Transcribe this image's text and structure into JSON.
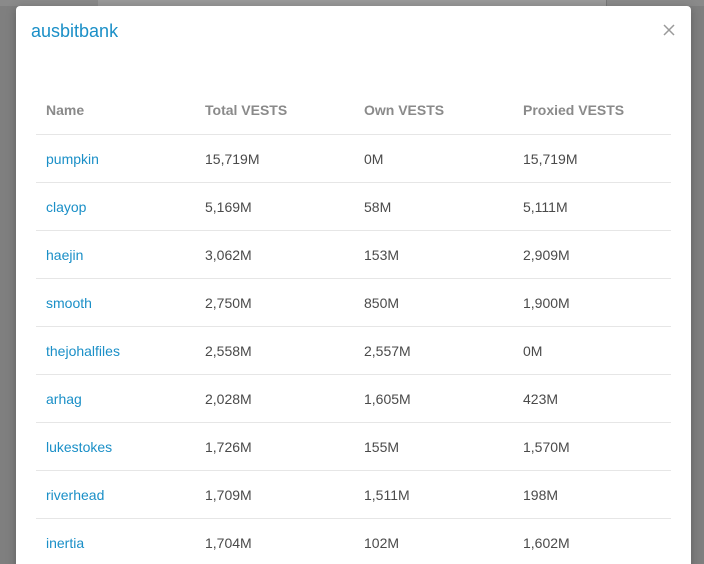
{
  "modal": {
    "title": "ausbitbank",
    "close_label": "×"
  },
  "table": {
    "headers": [
      "Name",
      "Total VESTS",
      "Own VESTS",
      "Proxied VESTS"
    ],
    "rows": [
      {
        "name": "pumpkin",
        "total": "15,719M",
        "own": "0M",
        "proxied": "15,719M"
      },
      {
        "name": "clayop",
        "total": "5,169M",
        "own": "58M",
        "proxied": "5,111M"
      },
      {
        "name": "haejin",
        "total": "3,062M",
        "own": "153M",
        "proxied": "2,909M"
      },
      {
        "name": "smooth",
        "total": "2,750M",
        "own": "850M",
        "proxied": "1,900M"
      },
      {
        "name": "thejohalfiles",
        "total": "2,558M",
        "own": "2,557M",
        "proxied": "0M"
      },
      {
        "name": "arhag",
        "total": "2,028M",
        "own": "1,605M",
        "proxied": "423M"
      },
      {
        "name": "lukestokes",
        "total": "1,726M",
        "own": "155M",
        "proxied": "1,570M"
      },
      {
        "name": "riverhead",
        "total": "1,709M",
        "own": "1,511M",
        "proxied": "198M"
      },
      {
        "name": "inertia",
        "total": "1,704M",
        "own": "102M",
        "proxied": "1,602M"
      }
    ]
  },
  "colors": {
    "link": "#1a8fc7",
    "header_text": "#8a8a8a",
    "cell_text": "#4a4a4a",
    "overlay": "#7f7f7f"
  }
}
